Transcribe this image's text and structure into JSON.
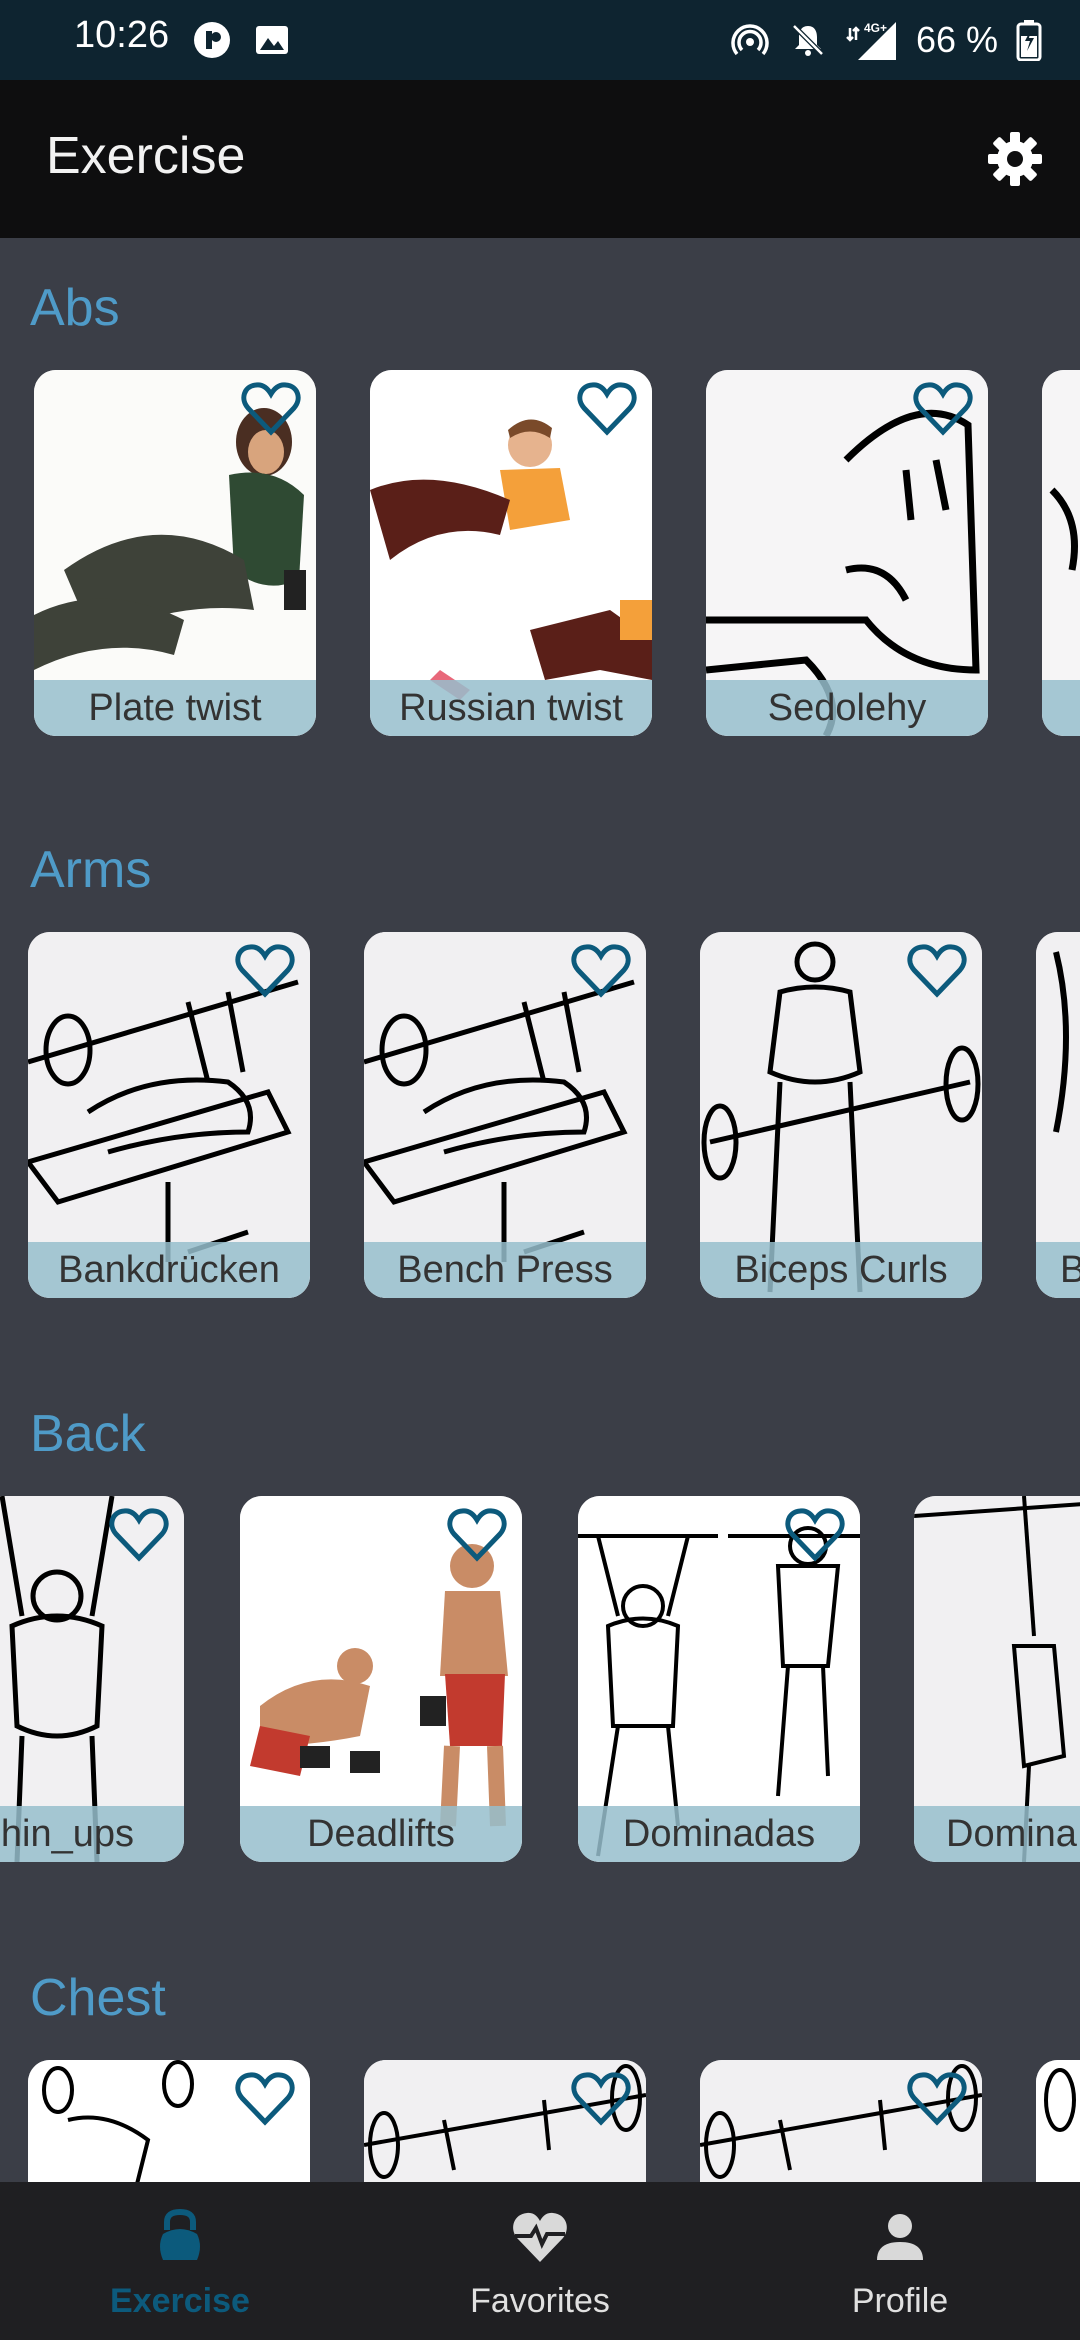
{
  "status": {
    "time": "10:26",
    "battery": "66 %",
    "network": "4G+"
  },
  "header": {
    "title": "Exercise"
  },
  "sections": [
    {
      "title": "Abs",
      "cards": [
        "Plate twist",
        "Russian twist",
        "Sedolehy",
        ""
      ]
    },
    {
      "title": "Arms",
      "cards": [
        "Bankdrücken",
        "Bench Press",
        "Biceps Curls",
        "B"
      ]
    },
    {
      "title": "Back",
      "cards": [
        "hin_ups",
        "Deadlifts",
        "Dominadas",
        "Domina"
      ]
    },
    {
      "title": "Chest",
      "cards": [
        "",
        "",
        "",
        ""
      ]
    }
  ],
  "nav": {
    "exercise": "Exercise",
    "favorites": "Favorites",
    "profile": "Profile"
  },
  "colors": {
    "accent": "#4f9bc8",
    "heart": "#0c5a7c",
    "active_nav": "#0c5a7c"
  }
}
